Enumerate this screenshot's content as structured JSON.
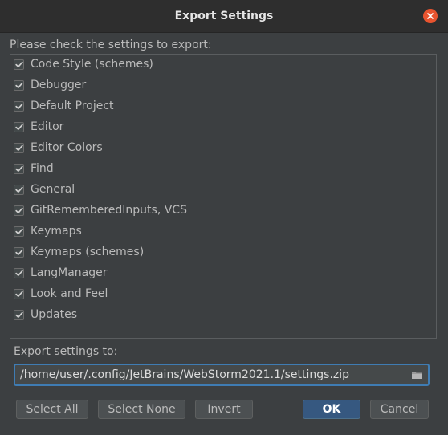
{
  "window": {
    "title": "Export Settings",
    "close_icon": "close-icon",
    "close_color": "#e9542f"
  },
  "instruction": "Please check the settings to export:",
  "settings_items": [
    {
      "label": "Code Style (schemes)",
      "checked": true
    },
    {
      "label": "Debugger",
      "checked": true
    },
    {
      "label": "Default Project",
      "checked": true
    },
    {
      "label": "Editor",
      "checked": true
    },
    {
      "label": "Editor Colors",
      "checked": true
    },
    {
      "label": "Find",
      "checked": true
    },
    {
      "label": "General",
      "checked": true
    },
    {
      "label": "GitRememberedInputs, VCS",
      "checked": true
    },
    {
      "label": "Keymaps",
      "checked": true
    },
    {
      "label": "Keymaps (schemes)",
      "checked": true
    },
    {
      "label": "LangManager",
      "checked": true
    },
    {
      "label": "Look and Feel",
      "checked": true
    },
    {
      "label": "Updates",
      "checked": true
    }
  ],
  "export_path": {
    "label": "Export settings to:",
    "value": "/home/user/.config/JetBrains/WebStorm2021.1/settings.zip",
    "browse_icon": "folder-icon"
  },
  "buttons": {
    "select_all": "Select All",
    "select_none": "Select None",
    "invert": "Invert",
    "ok": "OK",
    "cancel": "Cancel"
  },
  "colors": {
    "background": "#3c3f41",
    "titlebar": "#2e2e2e",
    "accent": "#365880",
    "focus_border": "#3f7cb3"
  }
}
